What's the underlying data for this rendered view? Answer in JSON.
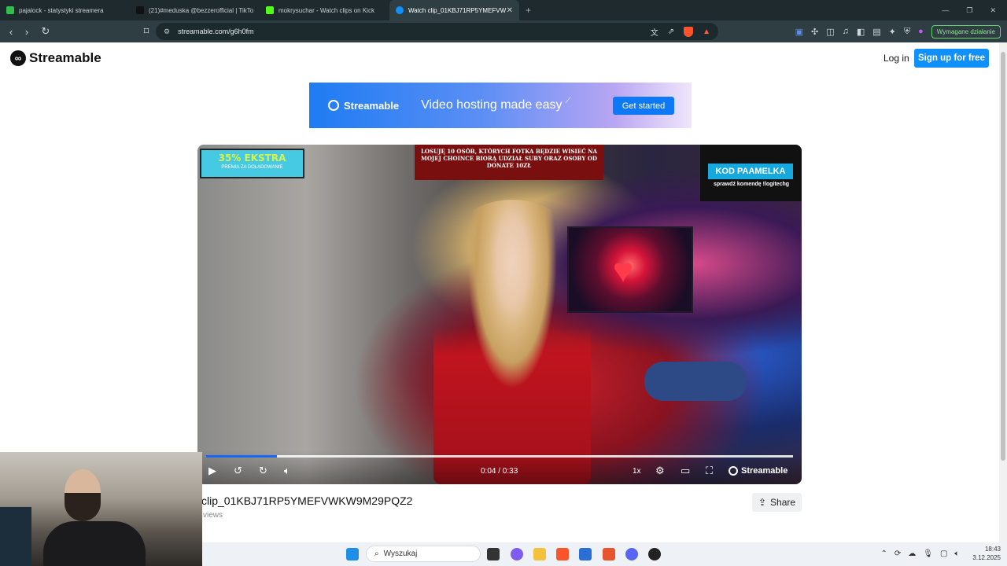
{
  "browser": {
    "tabs": [
      {
        "label": "pajalock - statystyki streamera",
        "favicon_color": "#2fbf4a"
      },
      {
        "label": "(21)#meduska @bezzerofficial | TikTo",
        "favicon_color": "#111111"
      },
      {
        "label": "mokrysuchar - Watch clips on Kick",
        "favicon_color": "#53fc18"
      },
      {
        "label": "Watch clip_01KBJ71RP5YMEFVW",
        "favicon_color": "#0f90fa"
      }
    ],
    "new_tab": "+",
    "url": "streamable.com/g6h0fm",
    "action_required": "Wymagane działanie"
  },
  "site": {
    "logo_text": "Streamable",
    "login": "Log in",
    "signup": "Sign up for free"
  },
  "banner": {
    "brand": "Streamable",
    "tagline": "Video hosting made easy",
    "cta": "Get started"
  },
  "video": {
    "overlay_left_main": "35% EKSTRA",
    "overlay_left_sub": "PREMIA ZA DOŁADOWANIE",
    "overlay_center": "LOSUJĘ 10 OSÓB, KTÓRYCH FOTKA BĘDZIE WISIEĆ NA MOJEJ CHOINCE BIORĄ UDZIAŁ SUBY ORAZ OSOBY OD DONATE 10ZŁ",
    "overlay_right_code": "KOD PAAMELKA",
    "overlay_right_sub": "sprawdź komendę !logitechg",
    "time": "0:04 / 0:33",
    "progress": 0.12,
    "speed": "1x",
    "watermark": "Streamable"
  },
  "clip": {
    "title": "clip_01KBJ71RP5YMEFVWKW9M29PQZ2",
    "views": "views",
    "share": "Share"
  },
  "taskbar": {
    "search_placeholder": "Wyszukaj",
    "time": "18:43",
    "date": "3.12.2025"
  }
}
